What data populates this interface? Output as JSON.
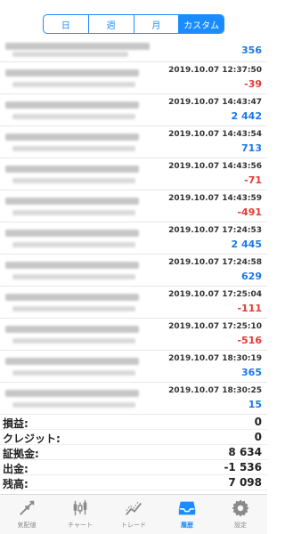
{
  "period_tabs": [
    {
      "label": "日",
      "active": false
    },
    {
      "label": "週",
      "active": false
    },
    {
      "label": "月",
      "active": false
    },
    {
      "label": "カスタム",
      "active": true
    }
  ],
  "history": [
    {
      "time": "",
      "amount": "356",
      "sign": "pos"
    },
    {
      "time": "2019.10.07 12:37:50",
      "amount": "-39",
      "sign": "neg"
    },
    {
      "time": "2019.10.07 14:43:47",
      "amount": "2 442",
      "sign": "pos"
    },
    {
      "time": "2019.10.07 14:43:54",
      "amount": "713",
      "sign": "pos"
    },
    {
      "time": "2019.10.07 14:43:56",
      "amount": "-71",
      "sign": "neg"
    },
    {
      "time": "2019.10.07 14:43:59",
      "amount": "-491",
      "sign": "neg"
    },
    {
      "time": "2019.10.07 17:24:53",
      "amount": "2 445",
      "sign": "pos"
    },
    {
      "time": "2019.10.07 17:24:58",
      "amount": "629",
      "sign": "pos"
    },
    {
      "time": "2019.10.07 17:25:04",
      "amount": "-111",
      "sign": "neg"
    },
    {
      "time": "2019.10.07 17:25:10",
      "amount": "-516",
      "sign": "neg"
    },
    {
      "time": "2019.10.07 18:30:19",
      "amount": "365",
      "sign": "pos"
    },
    {
      "time": "2019.10.07 18:30:25",
      "amount": "15",
      "sign": "pos"
    }
  ],
  "summary": {
    "profit_label": "損益:",
    "profit_value": "0",
    "credit_label": "クレジット:",
    "credit_value": "0",
    "deposit_label": "証拠金:",
    "deposit_value": "8 634",
    "withdrawal_label": "出金:",
    "withdrawal_value": "-1 536",
    "balance_label": "残高:",
    "balance_value": "7 098"
  },
  "tabbar": {
    "quotes": "気配値",
    "chart": "チャート",
    "trade": "トレード",
    "history": "履歴",
    "settings": "設定"
  },
  "colors": {
    "accent": "#1a8cff",
    "positive": "#1a78e6",
    "negative": "#e53935",
    "inactive": "#8a8a8a"
  }
}
